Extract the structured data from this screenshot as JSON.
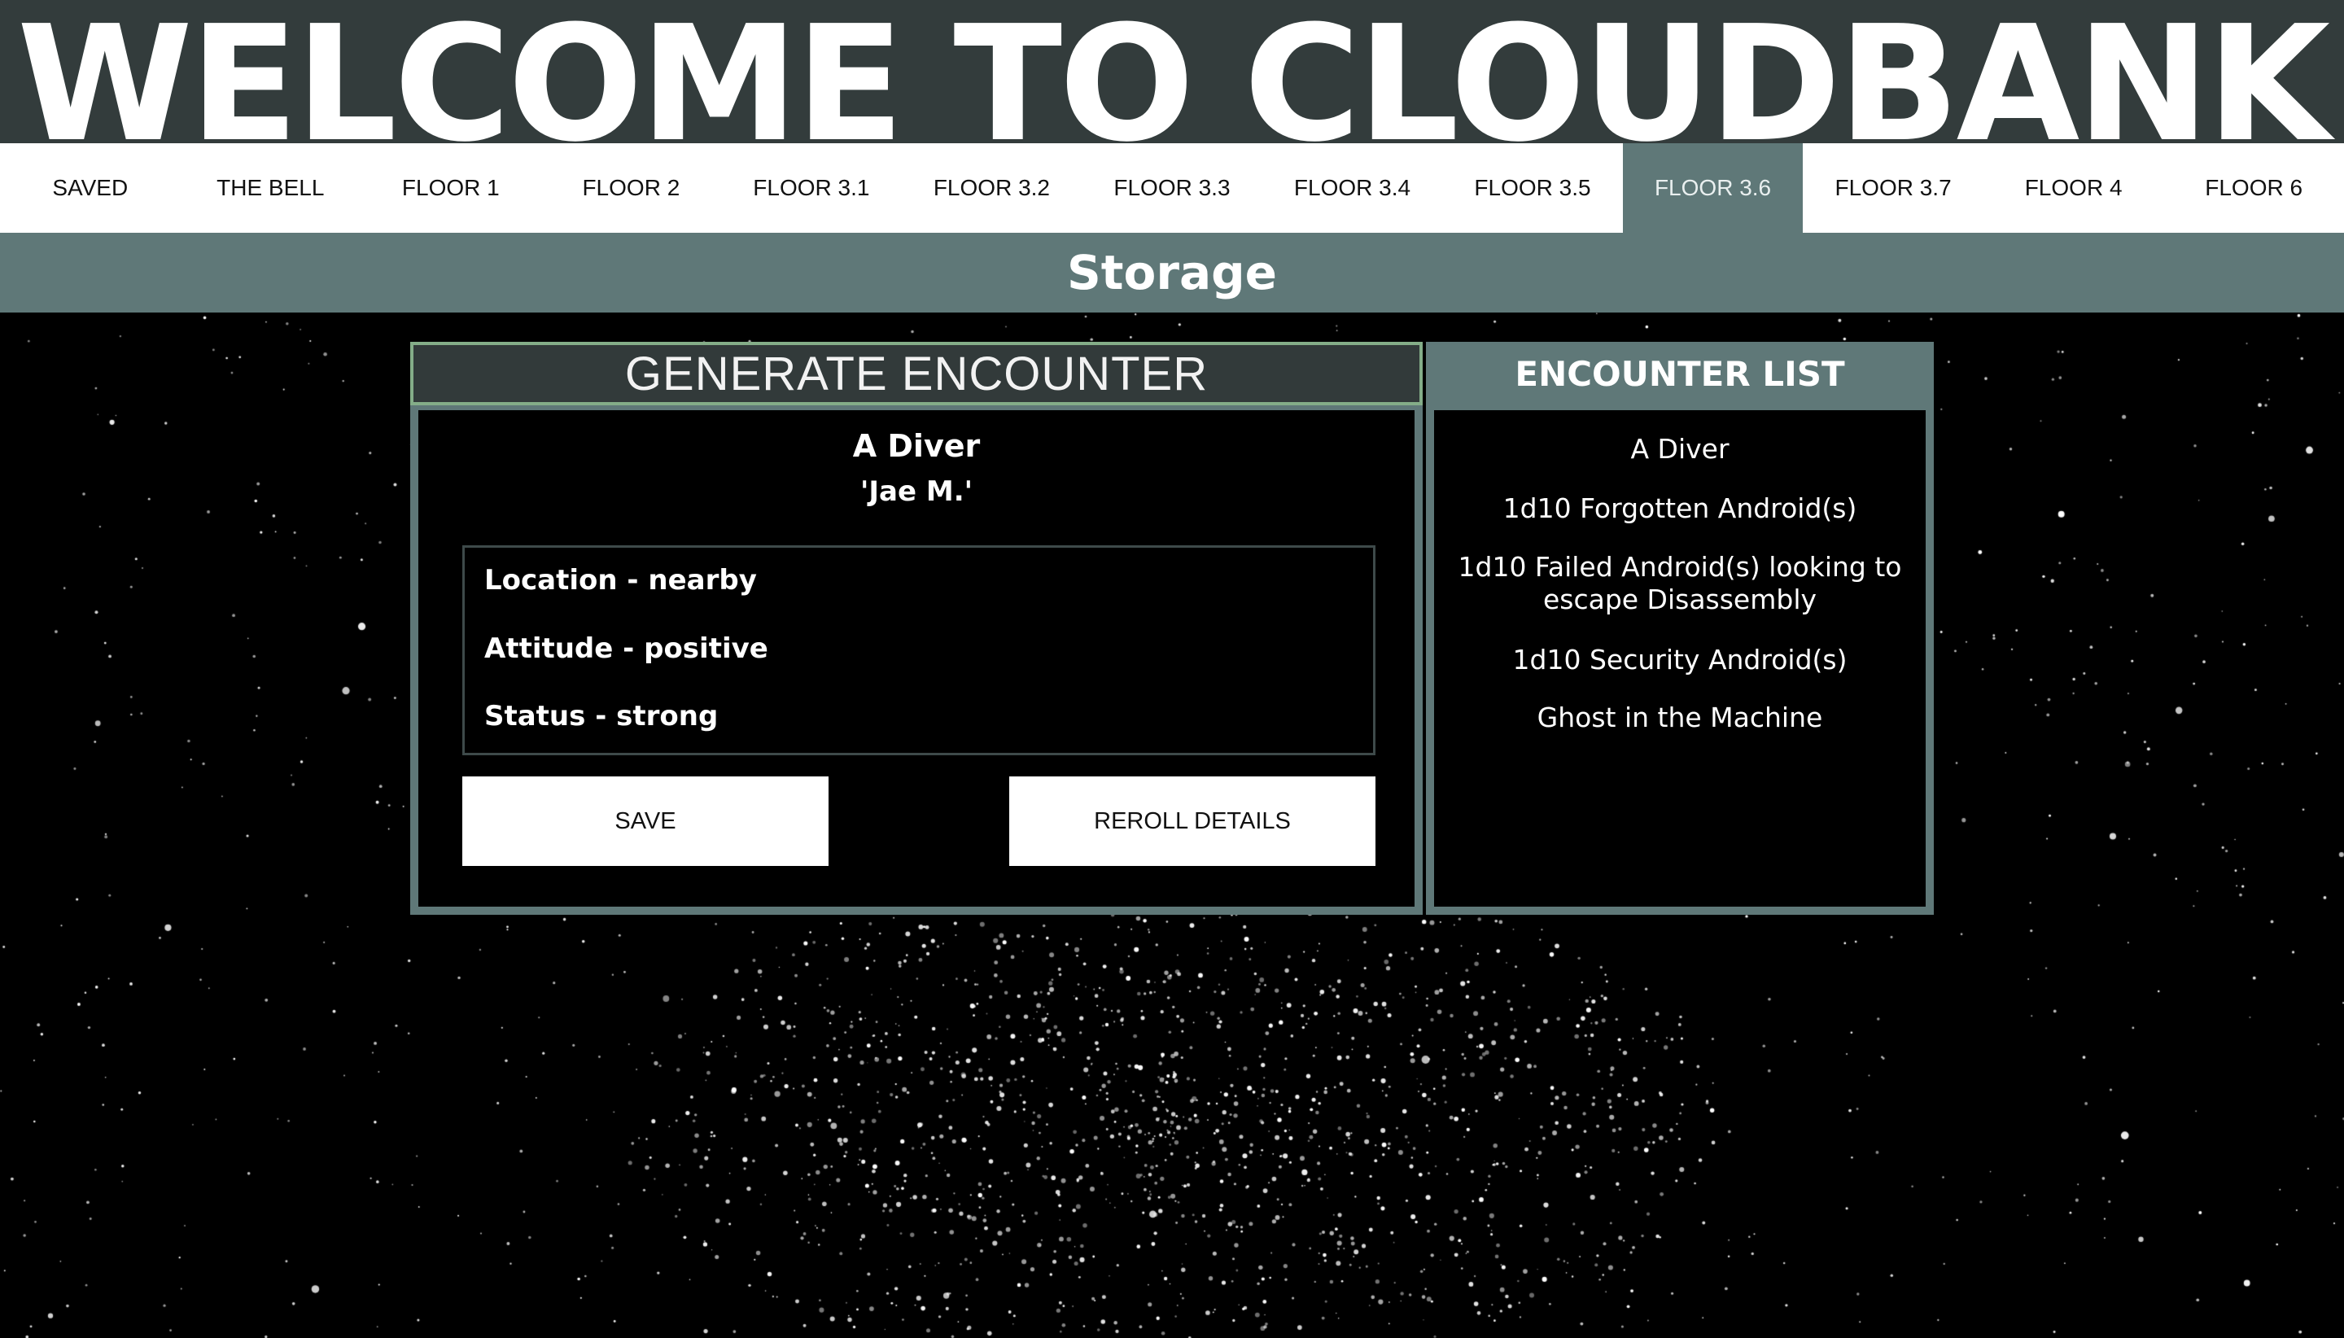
{
  "hero": {
    "title": "WELCOME TO CLOUDBANK"
  },
  "nav": {
    "tabs": [
      {
        "label": "SAVED"
      },
      {
        "label": "THE BELL"
      },
      {
        "label": "FLOOR 1"
      },
      {
        "label": "FLOOR 2"
      },
      {
        "label": "FLOOR 3.1"
      },
      {
        "label": "FLOOR 3.2"
      },
      {
        "label": "FLOOR 3.3"
      },
      {
        "label": "FLOOR 3.4"
      },
      {
        "label": "FLOOR 3.5"
      },
      {
        "label": "FLOOR 3.6",
        "active": true
      },
      {
        "label": "FLOOR 3.7"
      },
      {
        "label": "FLOOR 4"
      },
      {
        "label": "FLOOR 6"
      }
    ]
  },
  "section": {
    "title": "Storage"
  },
  "generator": {
    "heading": "GENERATE ENCOUNTER",
    "encounter_name": "A Diver",
    "encounter_sub": "'Jae M.'",
    "details": [
      "Location - nearby",
      "Attitude - positive",
      "Status - strong"
    ],
    "save_label": "SAVE",
    "reroll_label": "REROLL DETAILS"
  },
  "encounter_list": {
    "heading": "ENCOUNTER LIST",
    "items": [
      "A Diver",
      "1d10 Forgotten Android(s)",
      "1d10 Failed Android(s) looking to escape Disassembly",
      "1d10 Security Android(s)",
      "Ghost in the Machine"
    ]
  },
  "colors": {
    "hero_bg": "#333c3c",
    "teal": "#5f7878",
    "accent_border": "#84ad88",
    "background": "#000000"
  }
}
